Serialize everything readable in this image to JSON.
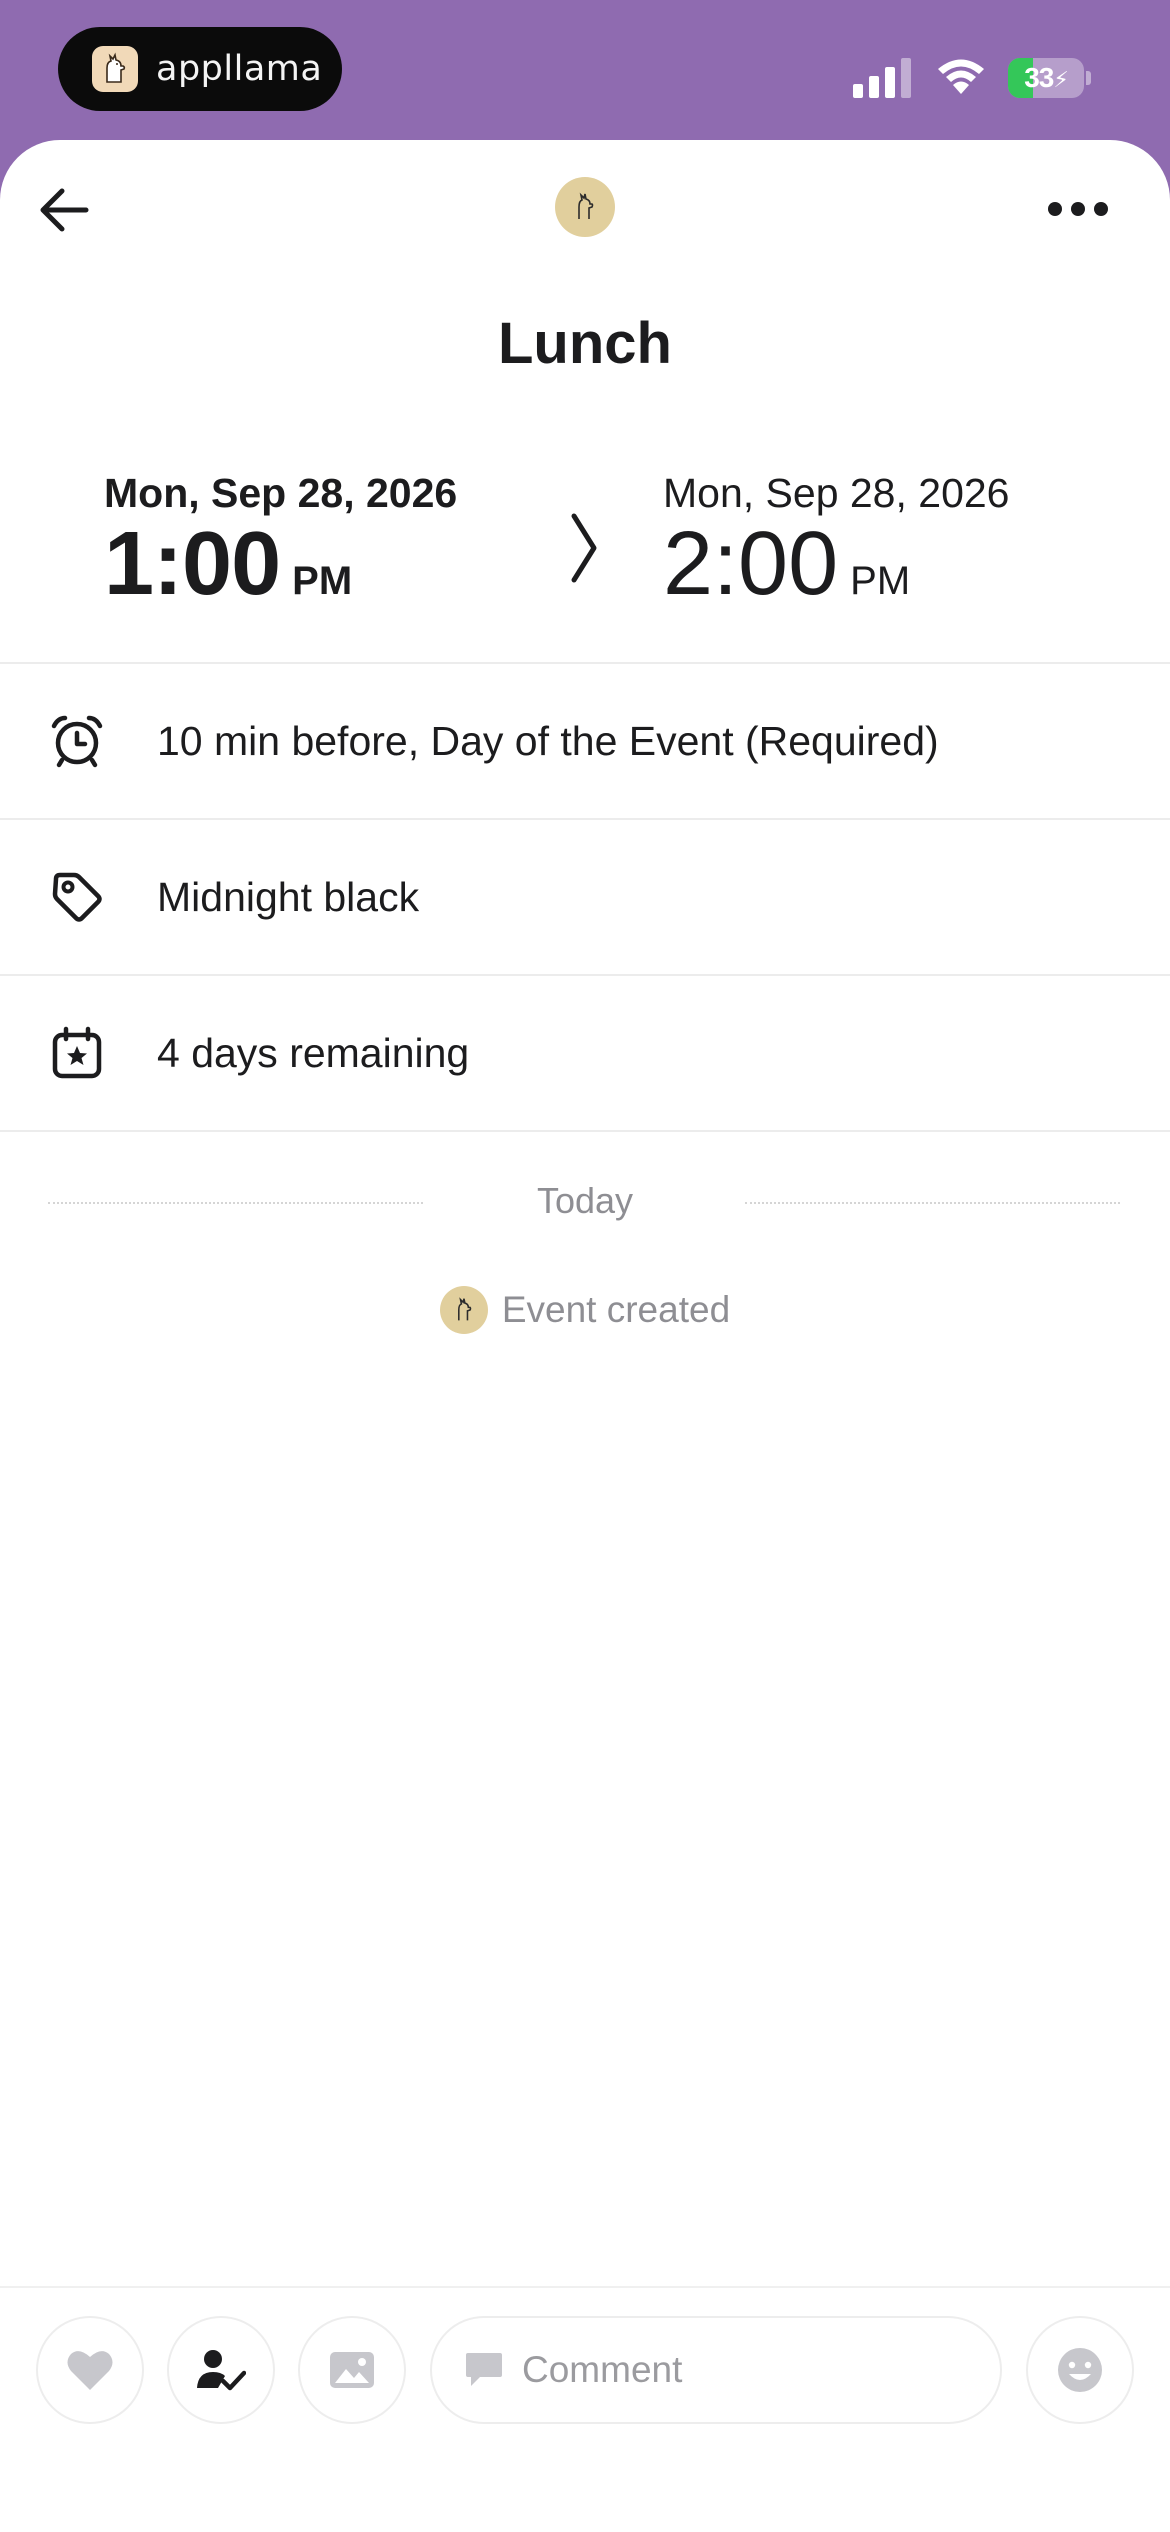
{
  "status_bar": {
    "island_label": "appllama",
    "battery_text": "33",
    "battery_level_percent": 33,
    "signal_icon": "cellular-signal-icon",
    "wifi_icon": "wifi-icon",
    "accent_color": "#8f6bb0"
  },
  "nav": {
    "back_icon": "arrow-left-icon",
    "more_icon": "ellipsis-icon",
    "avatar_icon": "llama-avatar-icon"
  },
  "event": {
    "title": "Lunch",
    "start": {
      "date": "Mon, Sep 28, 2026",
      "time": "1:00",
      "ampm": "PM"
    },
    "end": {
      "date": "Mon, Sep 28, 2026",
      "time": "2:00",
      "ampm": "PM"
    }
  },
  "details": {
    "reminder": {
      "icon": "alarm-clock-icon",
      "text": "10 min before, Day of the Event (Required)"
    },
    "tag": {
      "icon": "tag-icon",
      "text": "Midnight black"
    },
    "remaining": {
      "icon": "calendar-star-icon",
      "text": "4 days remaining"
    }
  },
  "activity": {
    "section_label": "Today",
    "items": [
      {
        "icon": "llama-avatar-icon",
        "text": "Event created"
      }
    ]
  },
  "bottom_bar": {
    "comment_placeholder": "Comment",
    "icons": [
      "heart-icon",
      "assign-person-icon",
      "image-icon",
      "comment-bubble-icon",
      "emoji-icon"
    ]
  }
}
